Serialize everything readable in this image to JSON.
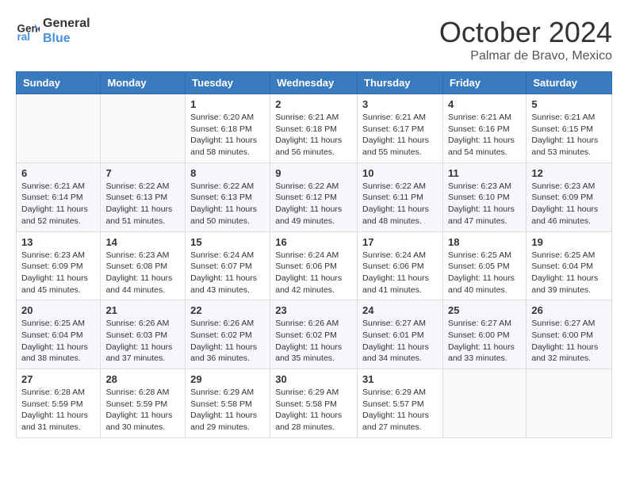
{
  "header": {
    "logo_line1": "General",
    "logo_line2": "Blue",
    "month": "October 2024",
    "location": "Palmar de Bravo, Mexico"
  },
  "days_of_week": [
    "Sunday",
    "Monday",
    "Tuesday",
    "Wednesday",
    "Thursday",
    "Friday",
    "Saturday"
  ],
  "weeks": [
    [
      {
        "day": "",
        "content": ""
      },
      {
        "day": "",
        "content": ""
      },
      {
        "day": "1",
        "content": "Sunrise: 6:20 AM\nSunset: 6:18 PM\nDaylight: 11 hours and 58 minutes."
      },
      {
        "day": "2",
        "content": "Sunrise: 6:21 AM\nSunset: 6:18 PM\nDaylight: 11 hours and 56 minutes."
      },
      {
        "day": "3",
        "content": "Sunrise: 6:21 AM\nSunset: 6:17 PM\nDaylight: 11 hours and 55 minutes."
      },
      {
        "day": "4",
        "content": "Sunrise: 6:21 AM\nSunset: 6:16 PM\nDaylight: 11 hours and 54 minutes."
      },
      {
        "day": "5",
        "content": "Sunrise: 6:21 AM\nSunset: 6:15 PM\nDaylight: 11 hours and 53 minutes."
      }
    ],
    [
      {
        "day": "6",
        "content": "Sunrise: 6:21 AM\nSunset: 6:14 PM\nDaylight: 11 hours and 52 minutes."
      },
      {
        "day": "7",
        "content": "Sunrise: 6:22 AM\nSunset: 6:13 PM\nDaylight: 11 hours and 51 minutes."
      },
      {
        "day": "8",
        "content": "Sunrise: 6:22 AM\nSunset: 6:13 PM\nDaylight: 11 hours and 50 minutes."
      },
      {
        "day": "9",
        "content": "Sunrise: 6:22 AM\nSunset: 6:12 PM\nDaylight: 11 hours and 49 minutes."
      },
      {
        "day": "10",
        "content": "Sunrise: 6:22 AM\nSunset: 6:11 PM\nDaylight: 11 hours and 48 minutes."
      },
      {
        "day": "11",
        "content": "Sunrise: 6:23 AM\nSunset: 6:10 PM\nDaylight: 11 hours and 47 minutes."
      },
      {
        "day": "12",
        "content": "Sunrise: 6:23 AM\nSunset: 6:09 PM\nDaylight: 11 hours and 46 minutes."
      }
    ],
    [
      {
        "day": "13",
        "content": "Sunrise: 6:23 AM\nSunset: 6:09 PM\nDaylight: 11 hours and 45 minutes."
      },
      {
        "day": "14",
        "content": "Sunrise: 6:23 AM\nSunset: 6:08 PM\nDaylight: 11 hours and 44 minutes."
      },
      {
        "day": "15",
        "content": "Sunrise: 6:24 AM\nSunset: 6:07 PM\nDaylight: 11 hours and 43 minutes."
      },
      {
        "day": "16",
        "content": "Sunrise: 6:24 AM\nSunset: 6:06 PM\nDaylight: 11 hours and 42 minutes."
      },
      {
        "day": "17",
        "content": "Sunrise: 6:24 AM\nSunset: 6:06 PM\nDaylight: 11 hours and 41 minutes."
      },
      {
        "day": "18",
        "content": "Sunrise: 6:25 AM\nSunset: 6:05 PM\nDaylight: 11 hours and 40 minutes."
      },
      {
        "day": "19",
        "content": "Sunrise: 6:25 AM\nSunset: 6:04 PM\nDaylight: 11 hours and 39 minutes."
      }
    ],
    [
      {
        "day": "20",
        "content": "Sunrise: 6:25 AM\nSunset: 6:04 PM\nDaylight: 11 hours and 38 minutes."
      },
      {
        "day": "21",
        "content": "Sunrise: 6:26 AM\nSunset: 6:03 PM\nDaylight: 11 hours and 37 minutes."
      },
      {
        "day": "22",
        "content": "Sunrise: 6:26 AM\nSunset: 6:02 PM\nDaylight: 11 hours and 36 minutes."
      },
      {
        "day": "23",
        "content": "Sunrise: 6:26 AM\nSunset: 6:02 PM\nDaylight: 11 hours and 35 minutes."
      },
      {
        "day": "24",
        "content": "Sunrise: 6:27 AM\nSunset: 6:01 PM\nDaylight: 11 hours and 34 minutes."
      },
      {
        "day": "25",
        "content": "Sunrise: 6:27 AM\nSunset: 6:00 PM\nDaylight: 11 hours and 33 minutes."
      },
      {
        "day": "26",
        "content": "Sunrise: 6:27 AM\nSunset: 6:00 PM\nDaylight: 11 hours and 32 minutes."
      }
    ],
    [
      {
        "day": "27",
        "content": "Sunrise: 6:28 AM\nSunset: 5:59 PM\nDaylight: 11 hours and 31 minutes."
      },
      {
        "day": "28",
        "content": "Sunrise: 6:28 AM\nSunset: 5:59 PM\nDaylight: 11 hours and 30 minutes."
      },
      {
        "day": "29",
        "content": "Sunrise: 6:29 AM\nSunset: 5:58 PM\nDaylight: 11 hours and 29 minutes."
      },
      {
        "day": "30",
        "content": "Sunrise: 6:29 AM\nSunset: 5:58 PM\nDaylight: 11 hours and 28 minutes."
      },
      {
        "day": "31",
        "content": "Sunrise: 6:29 AM\nSunset: 5:57 PM\nDaylight: 11 hours and 27 minutes."
      },
      {
        "day": "",
        "content": ""
      },
      {
        "day": "",
        "content": ""
      }
    ]
  ]
}
